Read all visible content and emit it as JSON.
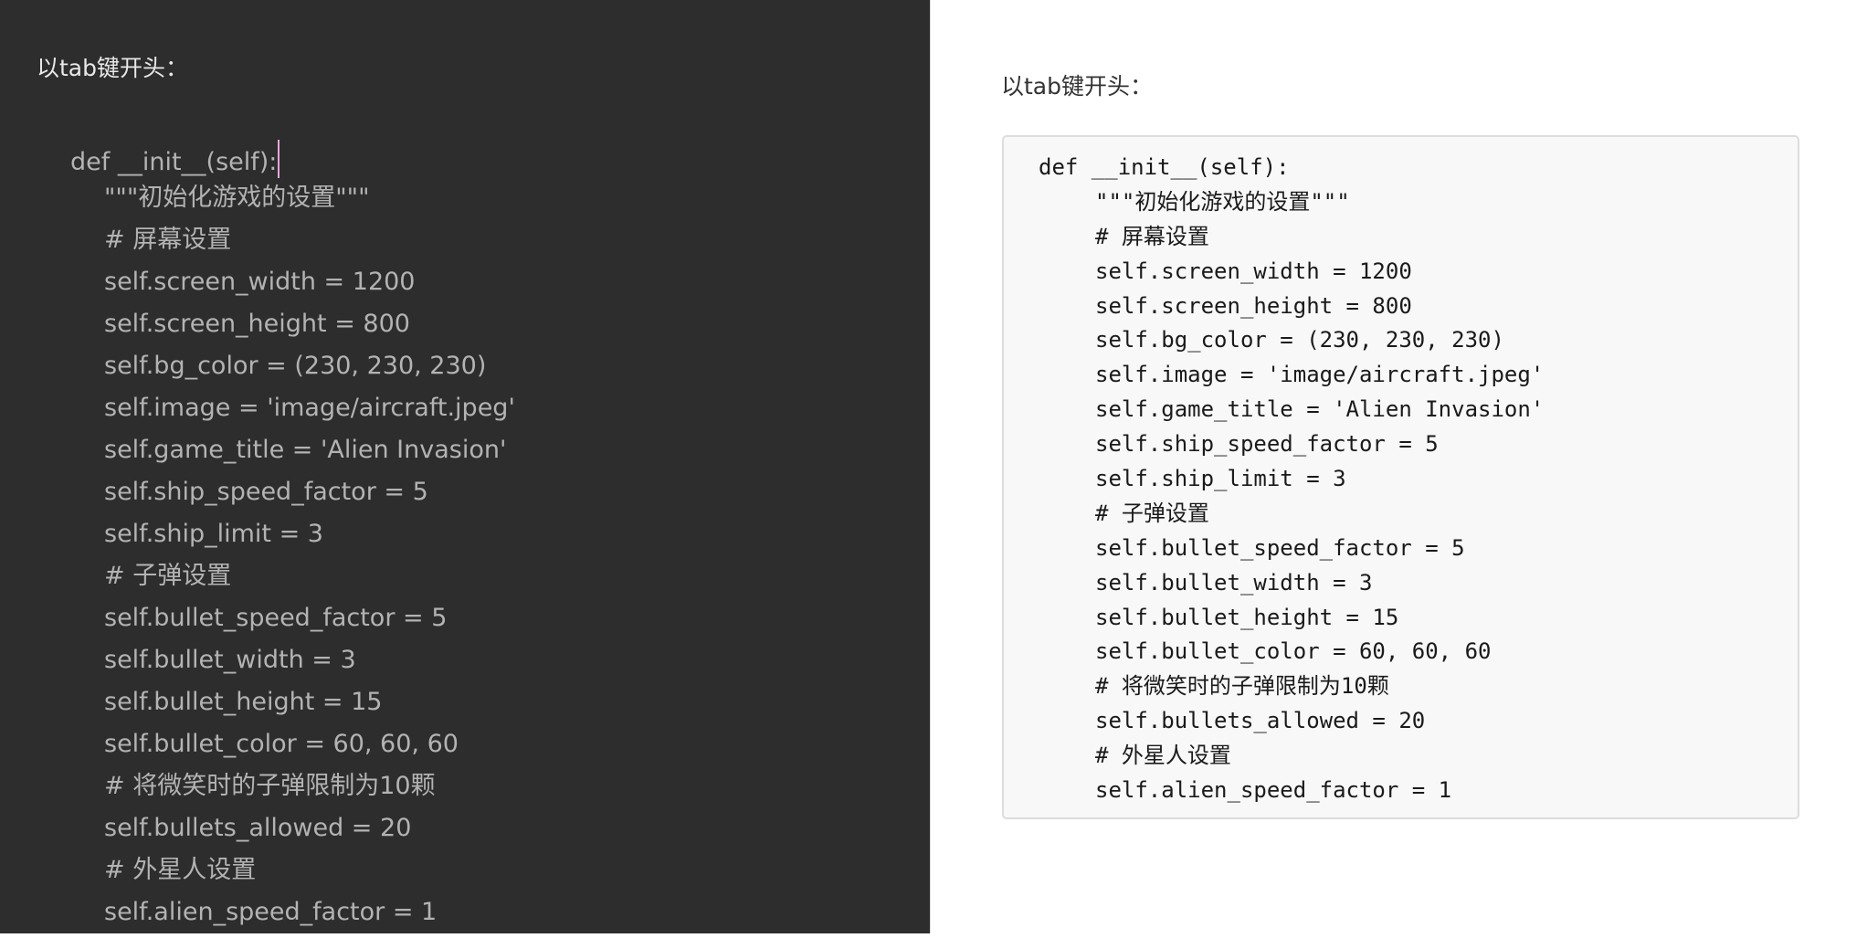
{
  "editor": {
    "heading": "以tab键开头：",
    "lines": [
      {
        "text": "def __init__(self):",
        "indent": 0,
        "cursor": true
      },
      {
        "text": "\"\"\"初始化游戏的设置\"\"\"",
        "indent": 1
      },
      {
        "text": "# 屏幕设置",
        "indent": 1
      },
      {
        "text": "self.screen_width = 1200",
        "indent": 1
      },
      {
        "text": "self.screen_height = 800",
        "indent": 1
      },
      {
        "text": "self.bg_color = (230, 230, 230)",
        "indent": 1
      },
      {
        "text": "self.image = 'image/aircraft.jpeg'",
        "indent": 1
      },
      {
        "text": "self.game_title = 'Alien Invasion'",
        "indent": 1
      },
      {
        "text": "self.ship_speed_factor = 5",
        "indent": 1
      },
      {
        "text": "self.ship_limit = 3",
        "indent": 1
      },
      {
        "text": "# 子弹设置",
        "indent": 1
      },
      {
        "text": "self.bullet_speed_factor = 5",
        "indent": 1
      },
      {
        "text": "self.bullet_width = 3",
        "indent": 1
      },
      {
        "text": "self.bullet_height = 15",
        "indent": 1
      },
      {
        "text": "self.bullet_color = 60, 60, 60",
        "indent": 1
      },
      {
        "text": "# 将微笑时的子弹限制为10颗",
        "indent": 1
      },
      {
        "text": "self.bullets_allowed = 20",
        "indent": 1
      },
      {
        "text": "# 外星人设置",
        "indent": 1
      },
      {
        "text": "self.alien_speed_factor = 1",
        "indent": 1
      }
    ]
  },
  "preview": {
    "heading": "以tab键开头：",
    "code_lines": [
      {
        "text": "def __init__(self):",
        "indent": 0
      },
      {
        "text": "\"\"\"初始化游戏的设置\"\"\"",
        "indent": 1
      },
      {
        "text": "# 屏幕设置",
        "indent": 1
      },
      {
        "text": "self.screen_width = 1200",
        "indent": 1
      },
      {
        "text": "self.screen_height = 800",
        "indent": 1
      },
      {
        "text": "self.bg_color = (230, 230, 230)",
        "indent": 1
      },
      {
        "text": "self.image = 'image/aircraft.jpeg'",
        "indent": 1
      },
      {
        "text": "self.game_title = 'Alien Invasion'",
        "indent": 1
      },
      {
        "text": "self.ship_speed_factor = 5",
        "indent": 1
      },
      {
        "text": "self.ship_limit = 3",
        "indent": 1
      },
      {
        "text": "# 子弹设置",
        "indent": 1
      },
      {
        "text": "self.bullet_speed_factor = 5",
        "indent": 1
      },
      {
        "text": "self.bullet_width = 3",
        "indent": 1
      },
      {
        "text": "self.bullet_height = 15",
        "indent": 1
      },
      {
        "text": "self.bullet_color = 60, 60, 60",
        "indent": 1
      },
      {
        "text": "# 将微笑时的子弹限制为10颗",
        "indent": 1
      },
      {
        "text": "self.bullets_allowed = 20",
        "indent": 1
      },
      {
        "text": "# 外星人设置",
        "indent": 1
      },
      {
        "text": "self.alien_speed_factor = 1",
        "indent": 1
      }
    ]
  },
  "colors": {
    "editor_bg": "#2d2d2d",
    "editor_text": "#b3b3b3",
    "caret": "#e6a7d8",
    "preview_bg": "#ffffff",
    "code_block_bg": "#f8f8f8"
  }
}
